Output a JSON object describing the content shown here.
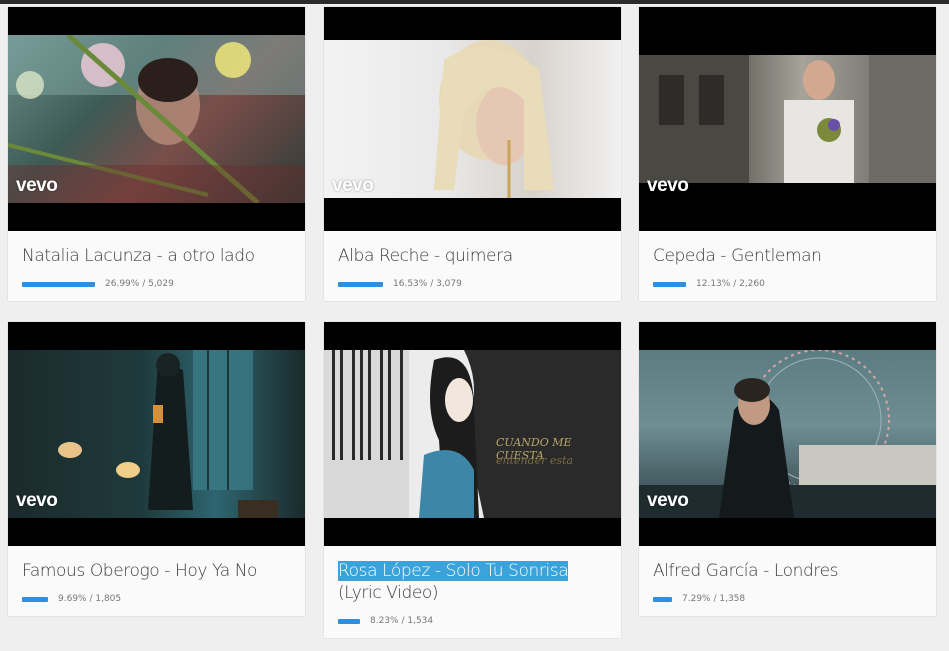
{
  "brand_label": "vevo",
  "accent_color": "#2e8fe0",
  "highlight_color": "#3aa3d9",
  "videos": [
    {
      "title": "Natalia Lacunza - a otro lado",
      "percent_label": "26.99%",
      "count": "5,029",
      "percent": 26.99
    },
    {
      "title": "Alba Reche - quimera",
      "percent_label": "16.53%",
      "count": "3,079",
      "percent": 16.53
    },
    {
      "title": "Cepeda - Gentleman",
      "percent_label": "12.13%",
      "count": "2,260",
      "percent": 12.13
    },
    {
      "title": "Famous Oberogo - Hoy Ya No",
      "percent_label": "9.69%",
      "count": "1,805",
      "percent": 9.69
    },
    {
      "title_highlight": "Rosa López - Solo Tu Sonrisa",
      "title_rest": " (Lyric Video)",
      "percent_label": "8.23%",
      "count": "1,534",
      "percent": 8.23,
      "overlay_line1": "CUANDO ME CUESTA",
      "overlay_line2": "entender esta"
    },
    {
      "title": "Alfred García - Londres",
      "percent_label": "7.29%",
      "count": "1,358",
      "percent": 7.29
    }
  ]
}
